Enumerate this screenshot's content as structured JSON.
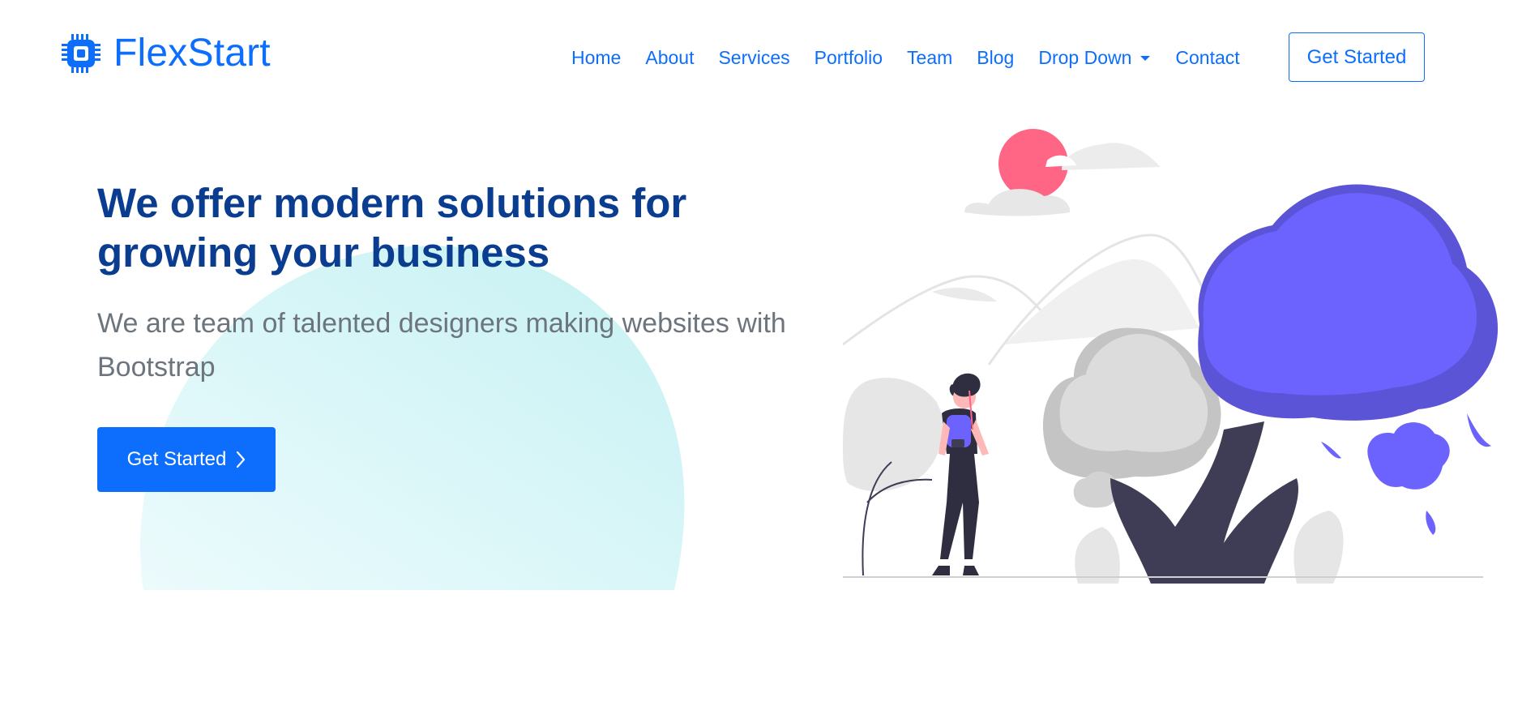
{
  "header": {
    "brand": "FlexStart",
    "nav": [
      {
        "label": "Home"
      },
      {
        "label": "About"
      },
      {
        "label": "Services"
      },
      {
        "label": "Portfolio"
      },
      {
        "label": "Team"
      },
      {
        "label": "Blog"
      },
      {
        "label": "Drop Down"
      },
      {
        "label": "Contact"
      }
    ],
    "cta_label": "Get Started"
  },
  "hero": {
    "title": "We offer modern solutions for growing your business",
    "subtitle": "We are team of talented designers making websites with Bootstrap",
    "cta_label": "Get Started"
  },
  "icons": {
    "logo": "chip-icon",
    "dropdown": "chevron-down-icon",
    "cta": "chevron-right-icon"
  },
  "colors": {
    "primary": "#0d6efd",
    "title": "#0a3d8f",
    "text_muted": "#6c757d",
    "blob": "#d3f5f7",
    "illustration_accent": "#6c63ff",
    "sun": "#ff6584"
  }
}
